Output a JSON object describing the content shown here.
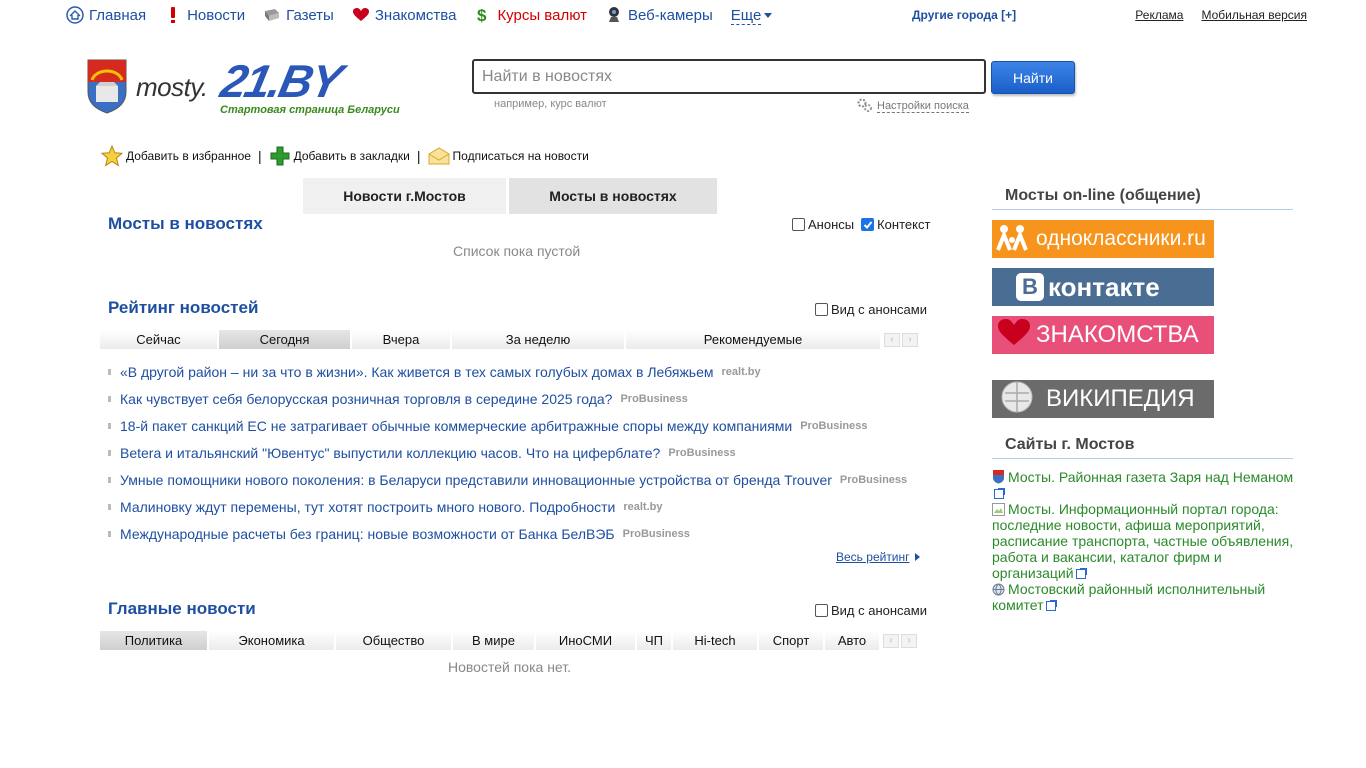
{
  "topnav": {
    "items": [
      {
        "label": "Главная",
        "icon": "home-icon"
      },
      {
        "label": "Новости",
        "icon": "exclamation-icon"
      },
      {
        "label": "Газеты",
        "icon": "newspaper-icon"
      },
      {
        "label": "Знакомства",
        "icon": "heart-icon"
      },
      {
        "label": "Курсы валют",
        "icon": "dollar-icon"
      },
      {
        "label": "Веб-камеры",
        "icon": "webcam-icon"
      }
    ],
    "more": "Еще",
    "other_cities": "Другие города [+]",
    "ads": "Реклама",
    "mobile": "Мобильная версия"
  },
  "logo": {
    "town": "mosty.",
    "brand": "21.BY",
    "slogan": "Стартовая страница Беларуси"
  },
  "search": {
    "placeholder": "Найти в новостях",
    "button": "Найти",
    "hint": "например, курс валют",
    "settings": "Настройки поиска"
  },
  "actions": {
    "favorites": "Добавить в избранное",
    "bookmarks": "Добавить в закладки",
    "subscribe": "Подписаться на новости"
  },
  "main_tabs": [
    {
      "label": "Новости г.Мостов",
      "active": false
    },
    {
      "label": "Мосты в новостях",
      "active": true
    }
  ],
  "section_mentions": {
    "title": "Мосты в новостях",
    "chk_anons": "Анонсы",
    "chk_context": "Контекст",
    "empty": "Список пока пустой"
  },
  "rating": {
    "title": "Рейтинг новостей",
    "chk": "Вид с анонсами",
    "tabs": [
      "Сейчас",
      "Сегодня",
      "Вчера",
      "За неделю",
      "Рекомендуемые"
    ],
    "active_tab": 1,
    "news": [
      {
        "title": "«В другой район – ни за что в жизни». Как живется в тех самых голубых домах в Лебяжьем",
        "source": "realt.by"
      },
      {
        "title": "Как чувствует себя белорусская розничная торговля в середине 2025 года?",
        "source": "ProBusiness"
      },
      {
        "title": "18-й пакет санкций ЕС не затрагивает обычные коммерческие арбитражные споры между компаниями",
        "source": "ProBusiness"
      },
      {
        "title": "Betera и итальянский \"Ювентус\" выпустили коллекцию часов. Что на циферблате?",
        "source": "ProBusiness"
      },
      {
        "title": "Умные помощники нового поколения: в Беларуси представили инновационные устройства от бренда Trouver",
        "source": "ProBusiness"
      },
      {
        "title": "Малиновку ждут перемены, тут хотят построить много нового. Подробности",
        "source": "realt.by"
      },
      {
        "title": "Международные расчеты без границ: новые возможности от Банка БелВЭБ",
        "source": "ProBusiness"
      }
    ],
    "all_link": "Весь рейтинг"
  },
  "main_news": {
    "title": "Главные новости",
    "chk": "Вид с анонсами",
    "tabs": [
      "Политика",
      "Экономика",
      "Общество",
      "В мире",
      "ИноСМИ",
      "ЧП",
      "Hi-tech",
      "Спорт",
      "Авто"
    ],
    "active_tab": 0,
    "empty": "Новостей пока нет."
  },
  "sidebar": {
    "online_title": "Мосты on-line (общение)",
    "banners": [
      {
        "label": "одноклассники.ru",
        "bg": "#f7941d"
      },
      {
        "label": "контакте",
        "prefix": "В",
        "bg": "#4a6d93"
      },
      {
        "label": "ЗНАКОМСТВА",
        "bg": "#e8507a"
      },
      {
        "label": "ВИКИПЕДИЯ",
        "bg": "#6b6b6b"
      }
    ],
    "sites_title": "Сайты г. Мостов",
    "sites": [
      {
        "label": "Мосты. Районная газета Заря над Неманом",
        "icon": "coat-of-arms-icon"
      },
      {
        "label": "Мосты. Информационный портал города: последние новости, афиша мероприятий, расписание транспорта, частные объявления, работа и вакансии, каталог фирм и организаций",
        "icon": "broken-image-icon"
      },
      {
        "label": "Мостовский районный исполнительный комитет",
        "icon": "globe-icon"
      }
    ]
  }
}
